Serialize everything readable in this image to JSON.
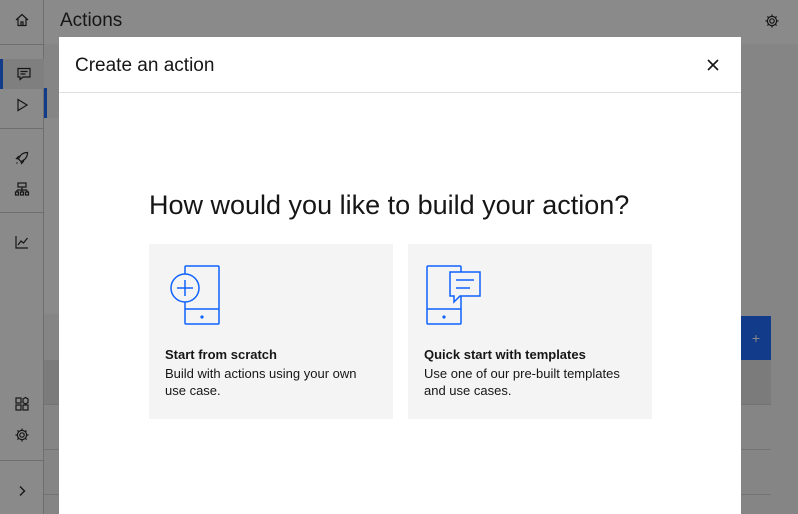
{
  "header": {
    "title": "Actions"
  },
  "rail": {
    "top_icons": [
      "home-icon",
      "chat-icon",
      "play-icon",
      "rocket-icon",
      "integration-icon",
      "analytics-icon"
    ],
    "bottom_icons": [
      "apps-icon",
      "settings-icon",
      "expand-icon"
    ]
  },
  "background": {
    "add_button_label": "+"
  },
  "modal": {
    "title": "Create an action",
    "question": "How would you like to build your action?",
    "tiles": [
      {
        "title": "Start from scratch",
        "description": "Build with actions using your own use case.",
        "icon": "phone-add-icon"
      },
      {
        "title": "Quick start with templates",
        "description": "Use one of our pre-built templates and use cases.",
        "icon": "phone-chat-icon"
      }
    ]
  },
  "colors": {
    "accent": "#0f62fe",
    "tile_bg": "#f4f4f4",
    "text": "#161616"
  }
}
